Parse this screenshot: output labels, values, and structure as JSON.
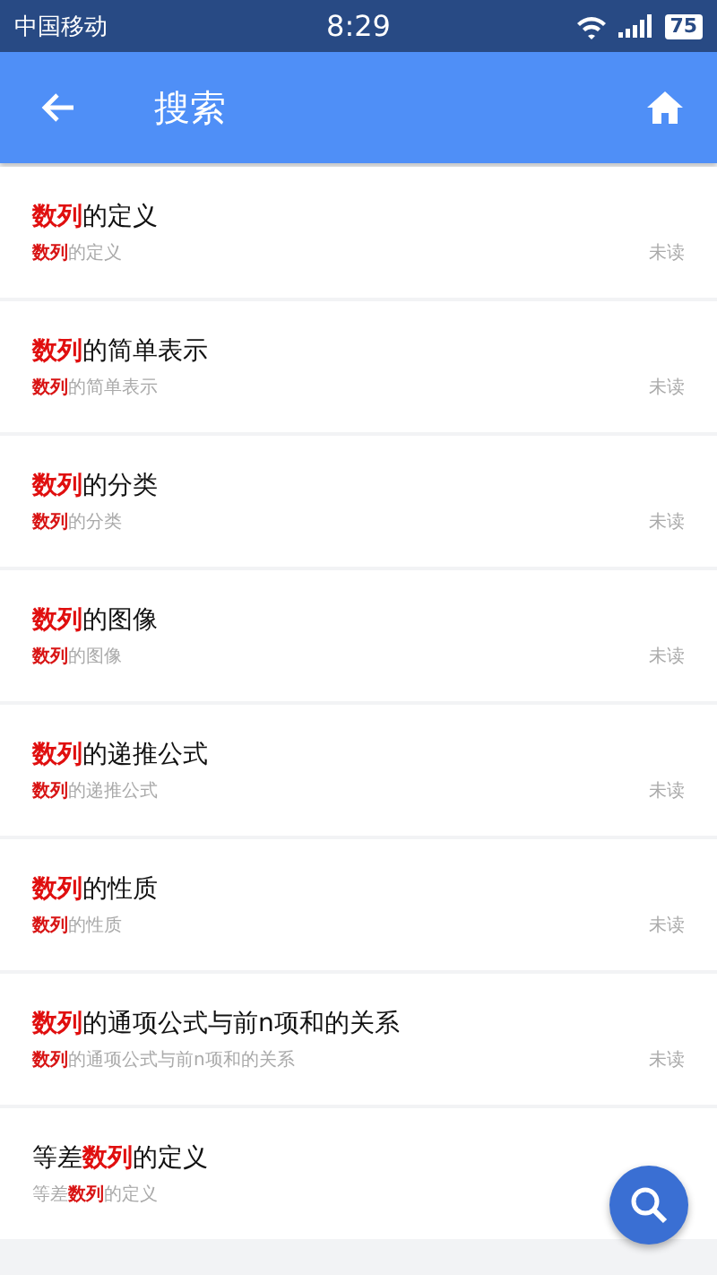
{
  "status_bar": {
    "carrier": "中国移动",
    "time": "8:29",
    "battery": "75"
  },
  "app_bar": {
    "title": "搜索"
  },
  "results": [
    {
      "title": "**数列**的定义",
      "snippet": "**数列**的定义",
      "status": "未读"
    },
    {
      "title": "**数列**的简单表示",
      "snippet": "**数列**的简单表示",
      "status": "未读"
    },
    {
      "title": "**数列**的分类",
      "snippet": "**数列**的分类",
      "status": "未读"
    },
    {
      "title": "**数列**的图像",
      "snippet": "**数列**的图像",
      "status": "未读"
    },
    {
      "title": "**数列**的递推公式",
      "snippet": "**数列**的递推公式",
      "status": "未读"
    },
    {
      "title": "**数列**的性质",
      "snippet": "**数列**的性质",
      "status": "未读"
    },
    {
      "title": "**数列**的通项公式与前n项和的关系",
      "snippet": "**数列**的通项公式与前n项和的关系",
      "status": "未读"
    },
    {
      "title": "等差**数列**的定义",
      "snippet": "等差**数列**的定义"
    }
  ]
}
